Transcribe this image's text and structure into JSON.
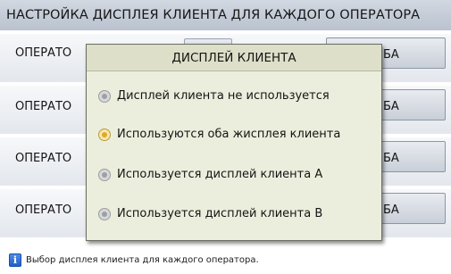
{
  "header": {
    "title": "НАСТРОЙКА ДИСПЛЕЯ КЛИЕНТА ДЛЯ КАЖДОГО ОПЕРАТОРА"
  },
  "operators": [
    {
      "label": "ОПЕРАТО",
      "value": "БА"
    },
    {
      "label": "ОПЕРАТО",
      "value": "БА"
    },
    {
      "label": "ОПЕРАТО",
      "value": "БА"
    },
    {
      "label": "ОПЕРАТО",
      "value": "БА"
    }
  ],
  "dialog": {
    "title": "ДИСПЛЕЙ КЛИЕНТА",
    "options": [
      {
        "label": "Дисплей клиента не используется",
        "selected": false
      },
      {
        "label": "Используются оба жисплея клиента",
        "selected": true
      },
      {
        "label": "Используется дисплей клиента А",
        "selected": false
      },
      {
        "label": "Используется дисплей клиента В",
        "selected": false
      }
    ]
  },
  "footer": {
    "icon": "info-icon",
    "icon_glyph": "i",
    "hint": "Выбор дисплея клиента для каждого оператора."
  }
}
